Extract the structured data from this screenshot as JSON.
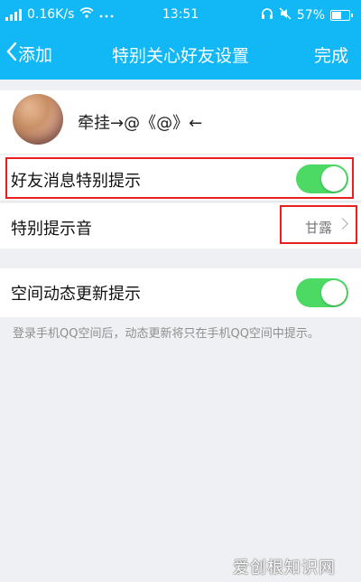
{
  "status_bar": {
    "speed": "0.16K/s",
    "time": "13:51",
    "battery": "57%",
    "battery_level": 0.57
  },
  "nav": {
    "back_label": "添加",
    "title": "特别关心好友设置",
    "done_label": "完成"
  },
  "friend": {
    "name": "牵挂→@《@》←"
  },
  "settings": {
    "special_message_alert": {
      "label": "好友消息特别提示",
      "enabled": true
    },
    "special_alert_sound": {
      "label": "特别提示音",
      "value": "甘露"
    },
    "space_update_alert": {
      "label": "空间动态更新提示",
      "enabled": true
    }
  },
  "note": "登录手机QQ空间后，动态更新将只在手机QQ空间中提示。",
  "watermark": "爱创根知识网",
  "colors": {
    "header": "#12b7f5",
    "toggle_on": "#4cd964",
    "highlight": "#e8201f"
  }
}
